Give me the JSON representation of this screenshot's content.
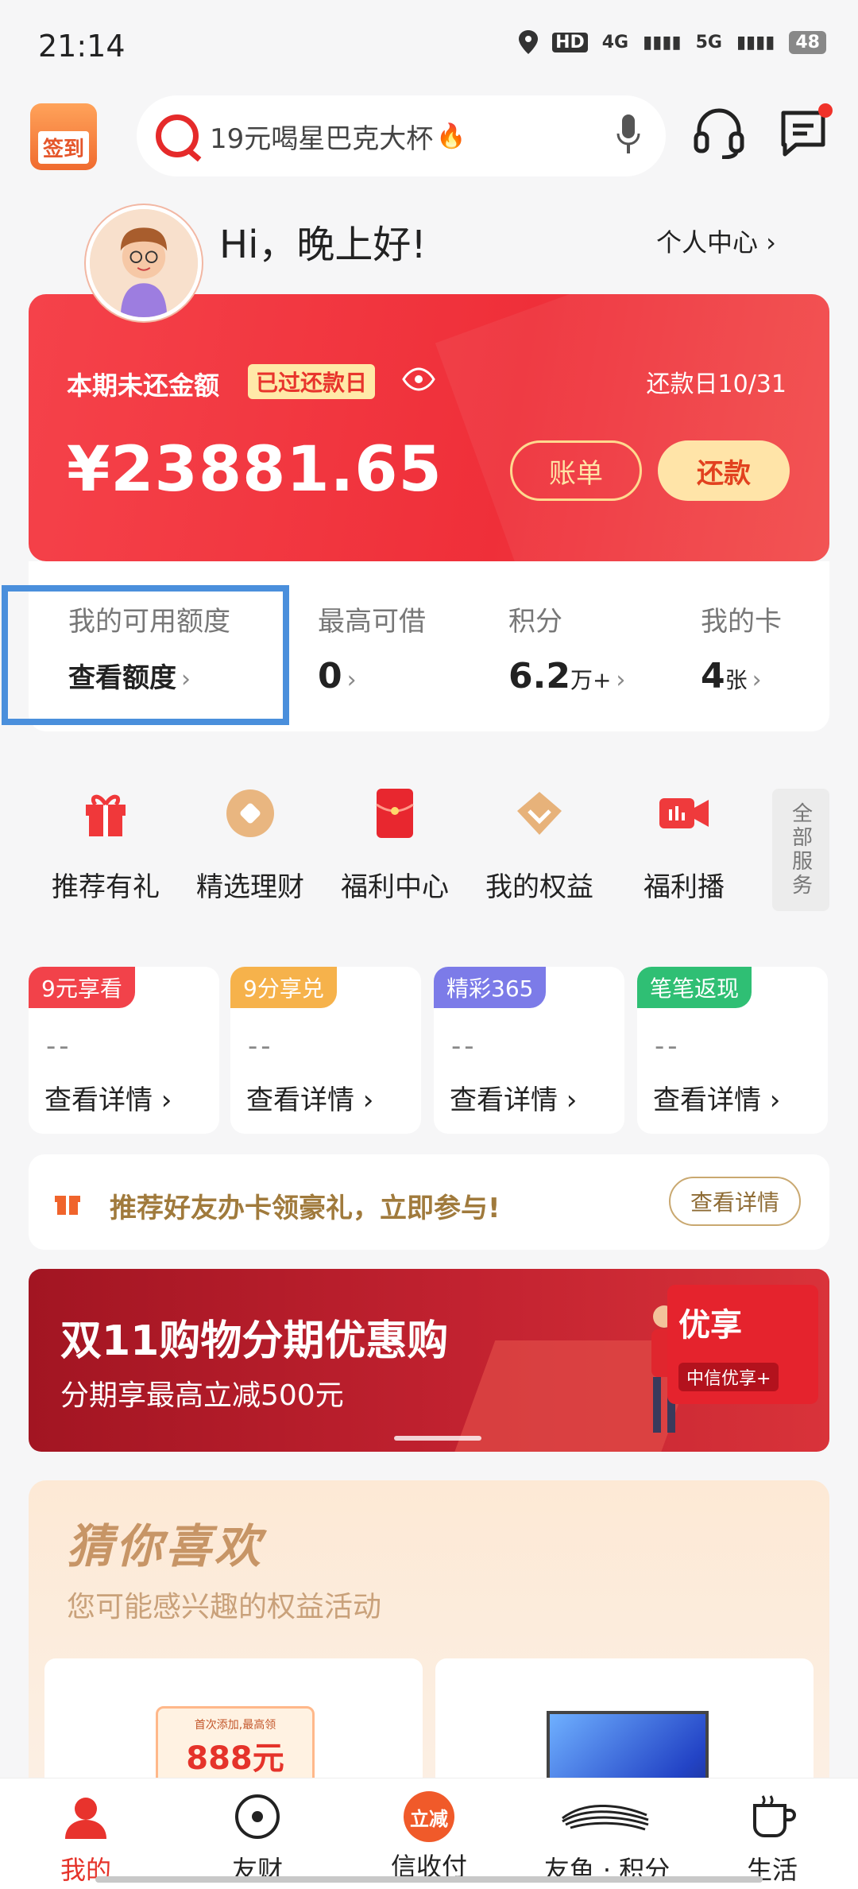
{
  "status_bar": {
    "time": "21:14",
    "hd_badge": "HD",
    "network1": "4G",
    "network2": "5G",
    "battery": "48"
  },
  "top_bar": {
    "signin_label": "签到",
    "search_placeholder": "19元喝星巴克大杯"
  },
  "greeting": {
    "text": "Hi，晚上好!",
    "personal_center": "个人中心 ›"
  },
  "bill_card": {
    "label": "本期未还金额",
    "overdue_tag": "已过还款日",
    "due_date": "还款日10/31",
    "amount": "¥23881.65",
    "bill_button": "账单",
    "pay_button": "还款"
  },
  "stats": [
    {
      "label": "我的可用额度",
      "value": "查看额度",
      "unit": ""
    },
    {
      "label": "最高可借",
      "value": "0",
      "unit": ""
    },
    {
      "label": "积分",
      "value": "6.2",
      "unit": "万+"
    },
    {
      "label": "我的卡",
      "value": "4",
      "unit": "张"
    }
  ],
  "services": [
    {
      "label": "推荐有礼",
      "icon": "gift-icon"
    },
    {
      "label": "精选理财",
      "icon": "coin-icon"
    },
    {
      "label": "福利中心",
      "icon": "red-envelope-icon"
    },
    {
      "label": "我的权益",
      "icon": "diamond-icon"
    },
    {
      "label": "福利播",
      "icon": "video-camera-icon"
    }
  ],
  "all_services": "全部服务",
  "promo_tiles": [
    {
      "tag": "9元享看",
      "value": "--",
      "link": "查看详情 ›",
      "color": "#f2424a"
    },
    {
      "tag": "9分享兑",
      "value": "--",
      "link": "查看详情 ›",
      "color": "#f6b24b"
    },
    {
      "tag": "精彩365",
      "value": "--",
      "link": "查看详情 ›",
      "color": "#7c7be8"
    },
    {
      "tag": "笔笔返现",
      "value": "--",
      "link": "查看详情 ›",
      "color": "#2fbf74"
    }
  ],
  "referral": {
    "text": "推荐好友办卡领豪礼，立即参与!",
    "button": "查看详情"
  },
  "banner": {
    "headline": "双11购物分期优惠购",
    "subline": "分期享最高立减500元",
    "badge": "优享",
    "badge_sub": "中信优享+"
  },
  "guess": {
    "title": "猜你喜欢",
    "subtitle": "您可能感兴趣的权益活动",
    "coupon_note": "首次添加,最高领",
    "coupon_amount": "888元"
  },
  "bottom_nav": [
    {
      "label": "我的",
      "icon": "person-icon",
      "active": true
    },
    {
      "label": "友财",
      "icon": "target-icon",
      "active": false
    },
    {
      "label": "信收付",
      "icon": "discount-badge-icon",
      "badge": "立减",
      "active": false
    },
    {
      "label": "友鱼 · 积分",
      "icon": "fish-icon",
      "active": false
    },
    {
      "label": "生活",
      "icon": "cup-icon",
      "active": false
    }
  ],
  "colors": {
    "brand_red": "#ef2f39",
    "gold": "#ffe4a8",
    "highlight_blue": "#4a8fdc"
  }
}
